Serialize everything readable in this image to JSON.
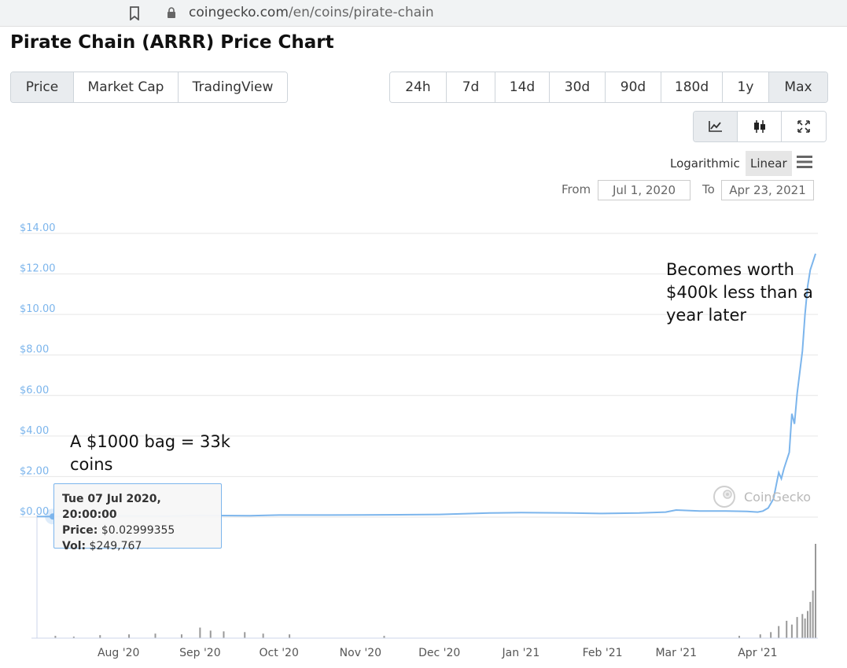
{
  "browser": {
    "url_host": "coingecko.com",
    "url_path": "/en/coins/pirate-chain"
  },
  "page": {
    "title": "Pirate Chain (ARRR) Price Chart"
  },
  "view_tabs": [
    {
      "label": "Price",
      "active": true
    },
    {
      "label": "Market Cap",
      "active": false
    },
    {
      "label": "TradingView",
      "active": false
    }
  ],
  "range_tabs": [
    {
      "label": "24h",
      "active": false
    },
    {
      "label": "7d",
      "active": false
    },
    {
      "label": "14d",
      "active": false
    },
    {
      "label": "30d",
      "active": false
    },
    {
      "label": "90d",
      "active": false
    },
    {
      "label": "180d",
      "active": false
    },
    {
      "label": "1y",
      "active": false
    },
    {
      "label": "Max",
      "active": true
    }
  ],
  "tools": {
    "line_icon": "line-chart-icon",
    "candle_icon": "candlestick-icon",
    "expand_icon": "expand-icon",
    "active": "line-chart-icon"
  },
  "scale": {
    "log_label": "Logarithmic",
    "linear_label": "Linear",
    "selected": "Linear"
  },
  "date_range": {
    "from_label": "From",
    "from_value": "Jul 1, 2020",
    "to_label": "To",
    "to_value": "Apr 23, 2021"
  },
  "tooltip": {
    "date": "Tue 07 Jul 2020, 20:00:00",
    "price_label": "Price:",
    "price_value": "$0.02999355",
    "vol_label": "Vol:",
    "vol_value": "$249,767"
  },
  "annotations": {
    "left": "A $1000 bag = 33k coins",
    "right": "Becomes worth $400k less than a year later"
  },
  "watermark": {
    "text": "CoinGecko"
  },
  "colors": {
    "line": "#7cb5ec",
    "axis_text": "#7cb5ec",
    "volume": "#999999",
    "grid": "#e6e6e6"
  },
  "chart_data": {
    "type": "line",
    "title": "",
    "xlabel": "",
    "ylabel": "",
    "ylim": [
      0,
      14
    ],
    "y_ticks": [
      "$0.00",
      "$2.00",
      "$4.00",
      "$6.00",
      "$8.00",
      "$10.00",
      "$12.00",
      "$14.00"
    ],
    "y_tick_values": [
      0,
      2,
      4,
      6,
      8,
      10,
      12,
      14
    ],
    "x_range": [
      "2020-07-01",
      "2021-04-23"
    ],
    "x_ticks": [
      {
        "label": "Aug '20",
        "date": "2020-08-01"
      },
      {
        "label": "Sep '20",
        "date": "2020-09-01"
      },
      {
        "label": "Oct '20",
        "date": "2020-10-01"
      },
      {
        "label": "Nov '20",
        "date": "2020-11-01"
      },
      {
        "label": "Dec '20",
        "date": "2020-12-01"
      },
      {
        "label": "Jan '21",
        "date": "2021-01-01"
      },
      {
        "label": "Feb '21",
        "date": "2021-02-01"
      },
      {
        "label": "Mar '21",
        "date": "2021-03-01"
      },
      {
        "label": "Apr '21",
        "date": "2021-04-01"
      }
    ],
    "grid": true,
    "legend": "none",
    "series": [
      {
        "x": [
          "2020-07-01",
          "2020-07-07",
          "2020-07-20",
          "2020-08-01",
          "2020-08-20",
          "2020-09-01",
          "2020-09-20",
          "2020-10-01",
          "2020-10-20",
          "2020-11-01",
          "2020-11-20",
          "2020-12-01",
          "2020-12-20",
          "2021-01-01",
          "2021-01-20",
          "2021-02-01",
          "2021-02-15",
          "2021-02-25",
          "2021-03-01",
          "2021-03-10",
          "2021-03-20",
          "2021-03-28",
          "2021-04-01",
          "2021-04-03",
          "2021-04-05",
          "2021-04-07",
          "2021-04-09",
          "2021-04-10",
          "2021-04-11",
          "2021-04-13",
          "2021-04-14",
          "2021-04-15",
          "2021-04-16",
          "2021-04-18",
          "2021-04-19",
          "2021-04-20",
          "2021-04-21",
          "2021-04-22",
          "2021-04-23"
        ],
        "values": [
          0.03,
          0.03,
          0.04,
          0.06,
          0.05,
          0.08,
          0.07,
          0.1,
          0.1,
          0.11,
          0.12,
          0.13,
          0.2,
          0.22,
          0.2,
          0.18,
          0.2,
          0.25,
          0.35,
          0.3,
          0.3,
          0.28,
          0.25,
          0.3,
          0.45,
          0.9,
          2.2,
          1.9,
          2.4,
          3.2,
          5.1,
          4.6,
          6.1,
          8.2,
          10.0,
          11.4,
          12.2,
          12.6,
          13.0
        ]
      }
    ],
    "volume": {
      "x": [
        "2020-07-08",
        "2020-07-15",
        "2020-07-25",
        "2020-08-05",
        "2020-08-15",
        "2020-08-25",
        "2020-09-01",
        "2020-09-05",
        "2020-09-10",
        "2020-09-18",
        "2020-09-25",
        "2020-10-05",
        "2020-11-10",
        "2021-03-25",
        "2021-04-02",
        "2021-04-06",
        "2021-04-09",
        "2021-04-12",
        "2021-04-14",
        "2021-04-16",
        "2021-04-18",
        "2021-04-19",
        "2021-04-20",
        "2021-04-21",
        "2021-04-22",
        "2021-04-23"
      ],
      "values": [
        0.3,
        0.2,
        0.4,
        0.5,
        0.6,
        0.5,
        1.4,
        1.0,
        0.9,
        0.8,
        0.6,
        0.5,
        0.3,
        0.3,
        0.5,
        0.8,
        1.6,
        2.3,
        1.8,
        2.8,
        3.2,
        2.6,
        3.6,
        4.8,
        6.3,
        12.5
      ]
    }
  }
}
